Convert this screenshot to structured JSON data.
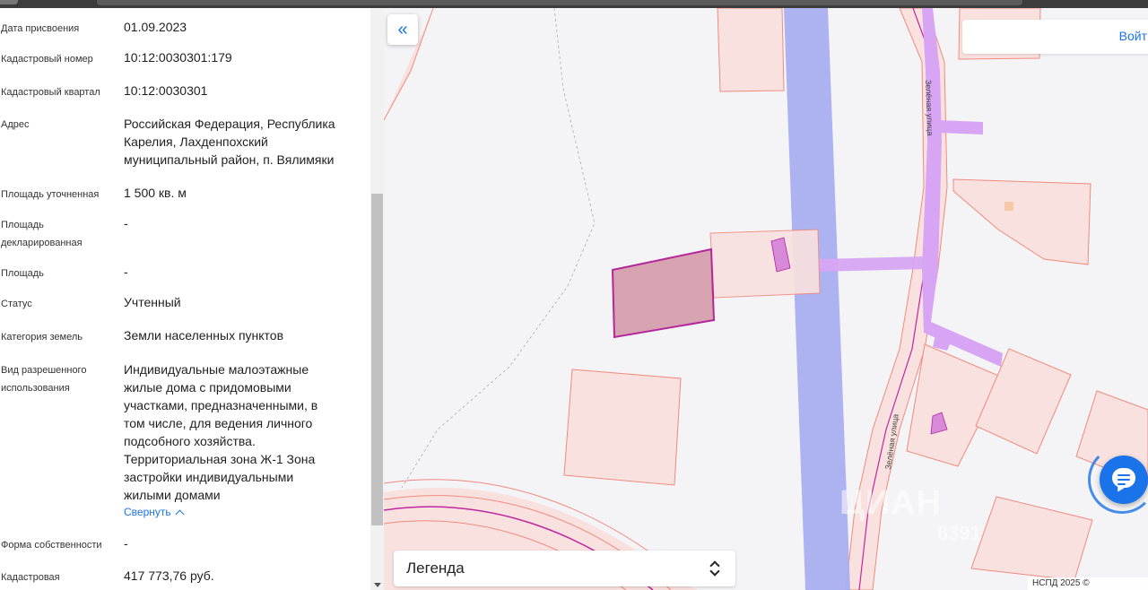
{
  "panel": {
    "rows": [
      {
        "label": "Дата присвоения",
        "value": "01.09.2023"
      },
      {
        "label": "Кадастровый номер",
        "value": "10:12:0030301:179"
      },
      {
        "label": "Кадастровый квартал",
        "value": "10:12:0030301"
      },
      {
        "label": "Адрес",
        "value": "Российская Федерация, Республика Карелия, Лахденпохский муниципальный район, п. Вялимяки"
      },
      {
        "label": "Площадь уточненная",
        "value": "1 500 кв. м"
      },
      {
        "label": "Площадь декларированная",
        "value": "-"
      },
      {
        "label": "Площадь",
        "value": "-"
      },
      {
        "label": "Статус",
        "value": "Учтенный"
      },
      {
        "label": "Категория земель",
        "value": "Земли населенных пунктов"
      },
      {
        "label": "Вид разрешенного использования",
        "value": "Индивидуальные малоэтажные жилые дома с придомовыми участками, предназначенными, в том числе, для ведения личного подсобного хозяйства. Территориальная зона Ж-1 Зона застройки индивидуальными жилыми домами"
      },
      {
        "label": "Форма собственности",
        "value": "-"
      },
      {
        "label": "Кадастровая",
        "value": "417 773,76 руб."
      }
    ],
    "collapse_link": "Свернуть"
  },
  "map": {
    "collapse_icon": "«",
    "login_label": "Войт",
    "street_label_top": "Зелёная улица",
    "street_label_bottom": "Зелёная улица",
    "legend_title": "Легенда",
    "copyright": "НСПД 2025 ©",
    "watermark": "ЦИАН",
    "watermark_id": "8391"
  },
  "icons": {
    "collapse": "double-chevron-left-icon",
    "legend_toggle": "sort-arrows-icon",
    "chat": "chat-icon",
    "expand": "chevron-up-icon"
  },
  "colors": {
    "accent": "#1a73e8",
    "parcel_fill": "#f9e1df",
    "parcel_stroke": "#f08b7e",
    "selected_fill": "#d8a3b0",
    "selected_stroke": "#b3279b",
    "road_blue": "#a9aef0",
    "road_violet": "#d7a5f3"
  }
}
